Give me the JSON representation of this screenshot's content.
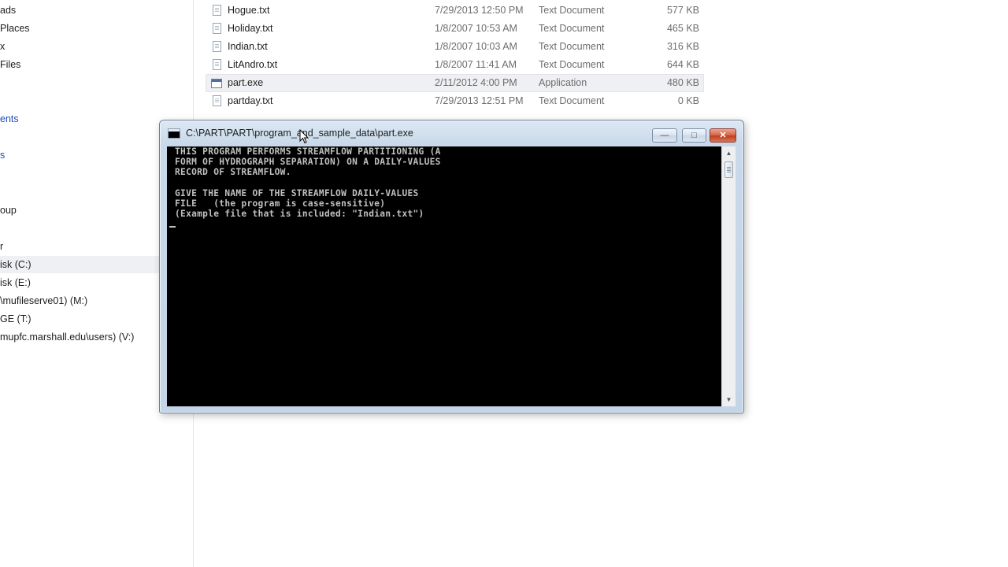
{
  "nav": {
    "items": [
      {
        "label": "ads",
        "style": ""
      },
      {
        "label": "Places",
        "style": ""
      },
      {
        "label": "x",
        "style": ""
      },
      {
        "label": "Files",
        "style": ""
      },
      {
        "label": "ents",
        "style": "blue"
      },
      {
        "label": "s",
        "style": "blue"
      },
      {
        "label": "oup",
        "style": ""
      },
      {
        "label": "r",
        "style": ""
      },
      {
        "label": "isk (C:)",
        "style": "selected"
      },
      {
        "label": "isk (E:)",
        "style": ""
      },
      {
        "label": "\\mufileserve01) (M:)",
        "style": ""
      },
      {
        "label": "GE (T:)",
        "style": ""
      },
      {
        "label": "mupfc.marshall.edu\\users) (V:)",
        "style": ""
      }
    ]
  },
  "files": [
    {
      "name": "Hogue.txt",
      "date": "7/29/2013 12:50 PM",
      "type": "Text Document",
      "size": "577 KB",
      "icon": "txt-file-icon"
    },
    {
      "name": "Holiday.txt",
      "date": "1/8/2007 10:53 AM",
      "type": "Text Document",
      "size": "465 KB",
      "icon": "txt-file-icon"
    },
    {
      "name": "Indian.txt",
      "date": "1/8/2007 10:03 AM",
      "type": "Text Document",
      "size": "316 KB",
      "icon": "txt-file-icon"
    },
    {
      "name": "LitAndro.txt",
      "date": "1/8/2007 11:41 AM",
      "type": "Text Document",
      "size": "644 KB",
      "icon": "txt-file-icon"
    },
    {
      "name": "part.exe",
      "date": "2/11/2012 4:00 PM",
      "type": "Application",
      "size": "480 KB",
      "icon": "exe-file-icon"
    },
    {
      "name": "partday.txt",
      "date": "7/29/2013 12:51 PM",
      "type": "Text Document",
      "size": "0 KB",
      "icon": "txt-file-icon"
    }
  ],
  "console": {
    "title": "C:\\PART\\PART\\program_and_sample_data\\part.exe",
    "minimize_glyph": "—",
    "maximize_glyph": "□",
    "close_glyph": "✕",
    "output": "THIS PROGRAM PERFORMS STREAMFLOW PARTITIONING (A\nFORM OF HYDROGRAPH SEPARATION) ON A DAILY-VALUES\nRECORD OF STREAMFLOW.\n\nGIVE THE NAME OF THE STREAMFLOW DAILY-VALUES\nFILE   (the program is case-sensitive)\n(Example file that is included: \"Indian.txt\")",
    "scroll_up_glyph": "▲",
    "scroll_down_glyph": "▼"
  },
  "colors": {
    "console_background": "#000000",
    "console_text": "#c0c0c0",
    "close_button": "#c94a2a",
    "selection": "#eef0f3"
  }
}
